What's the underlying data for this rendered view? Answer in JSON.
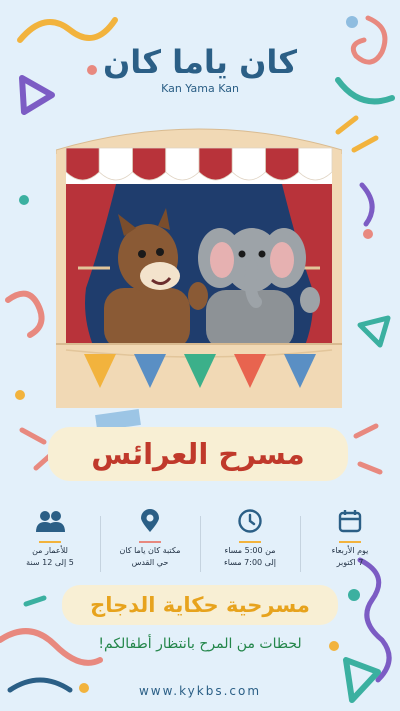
{
  "brand": {
    "name_ar": "كان ياما كان",
    "name_en": "Kan Yama Kan"
  },
  "event": {
    "title": "مسرح العرائس",
    "show_name": "مسرحية حكاية الدجاج",
    "tagline": "لحظات من المرح بانتظار أطفالكم!"
  },
  "details": [
    {
      "icon": "calendar-icon",
      "line1": "يوم الأربعاء",
      "line2": "7 اكتوبر"
    },
    {
      "icon": "clock-icon",
      "line1": "من 5:00 مساء",
      "line2": "إلى 7:00 مساء"
    },
    {
      "icon": "location-pin-icon",
      "line1": "مكتبة كان ياما كان",
      "line2": "حي القدس"
    },
    {
      "icon": "people-icon",
      "line1": "للأعمار من",
      "line2": "5  إلى 12 سنة"
    }
  ],
  "website": "www.kykbs.com",
  "colors": {
    "background": "#e3f0fa",
    "brand_blue": "#2b5f86",
    "title_red": "#c0392b",
    "show_yellow": "#e7a31d",
    "tagline_green": "#23864a",
    "curtain_red": "#b8333a"
  }
}
